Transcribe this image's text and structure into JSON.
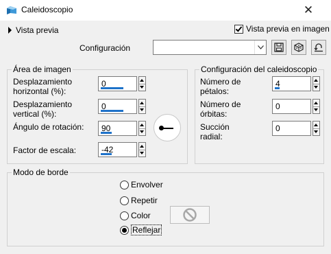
{
  "window": {
    "title": "Caleidoscopio",
    "close_glyph": "✕"
  },
  "preview": {
    "toggle_label": "Vista previa",
    "checkbox_label": "Vista previa en imagen",
    "checked": true
  },
  "config": {
    "label": "Configuración",
    "value": ""
  },
  "toolbar": {
    "icons": [
      "save-icon",
      "load-preset-icon",
      "reset-icon"
    ]
  },
  "image_area": {
    "title": "Área de imagen",
    "h_offset": {
      "label_line1": "Desplazamiento",
      "label_line2": "horizontal (%):",
      "value": "0"
    },
    "v_offset": {
      "label_line1": "Desplazamiento",
      "label_line2": "vertical (%):",
      "value": "0"
    },
    "rotation": {
      "label": "Ángulo de rotación:",
      "value": "90"
    },
    "scale": {
      "label": "Factor de escala:",
      "value": "-42"
    }
  },
  "kaleido": {
    "title": "Configuración del caleidoscopio",
    "petals": {
      "label_line1": "Número de",
      "label_line2": "pétalos:",
      "value": "4"
    },
    "orbits": {
      "label_line1": "Número de",
      "label_line2": "órbitas:",
      "value": "0"
    },
    "suction": {
      "label_line1": "Succión",
      "label_line2": "radial:",
      "value": "0"
    }
  },
  "border_mode": {
    "title": "Modo de borde",
    "options": [
      "Envolver",
      "Repetir",
      "Color",
      "Reflejar"
    ],
    "selected": "Reflejar"
  },
  "colors": {
    "accent": "#1e72c9",
    "background": "#f0f0f0"
  }
}
